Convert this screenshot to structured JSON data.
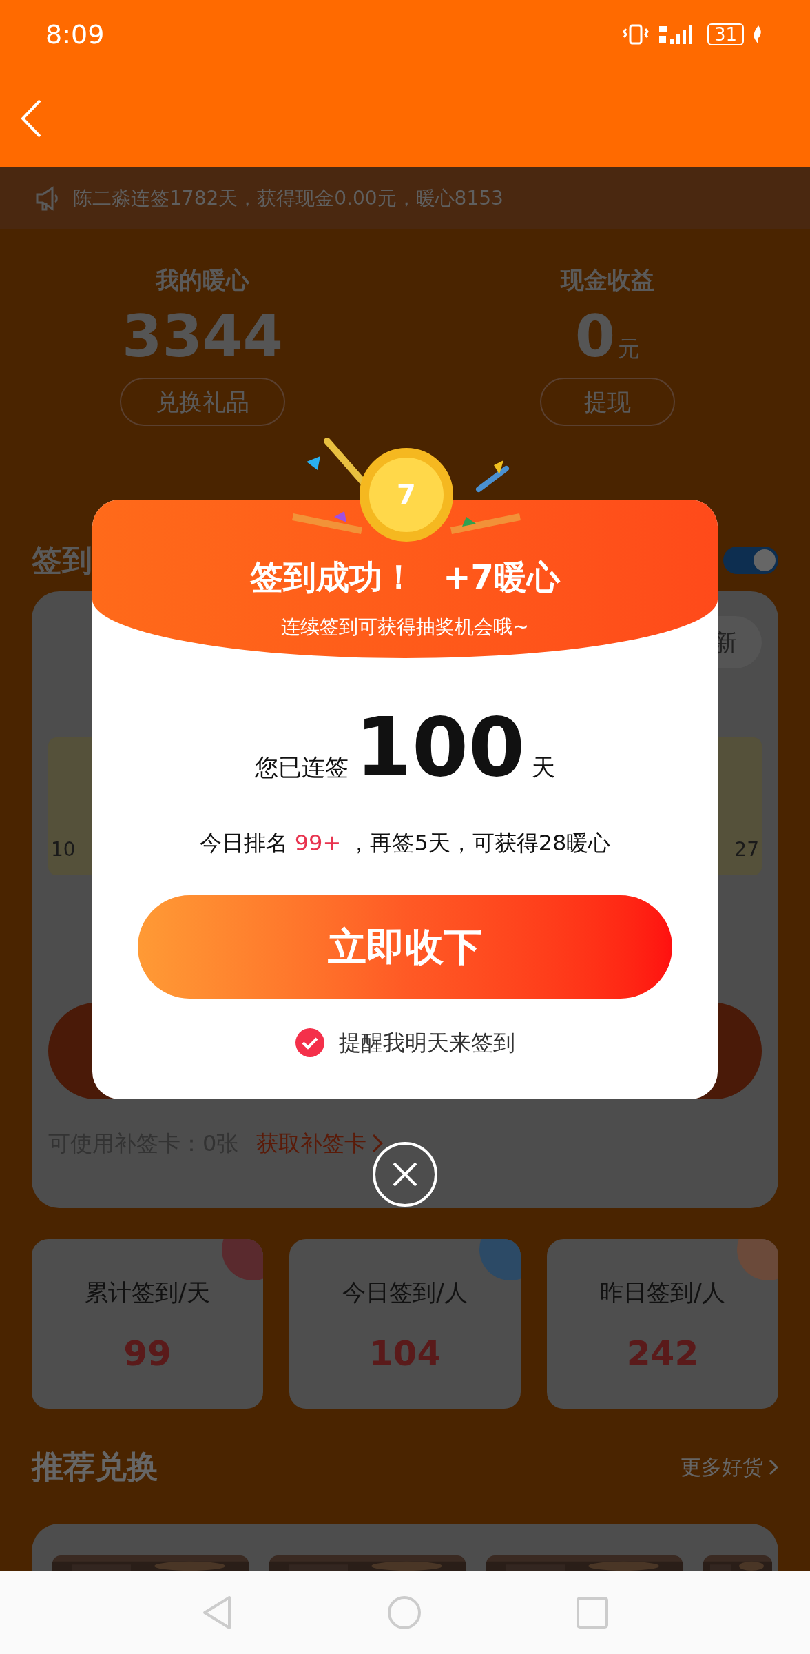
{
  "status_bar": {
    "time": "8:09",
    "battery": "31"
  },
  "ticker": {
    "text": "陈二淼连签1782天，获得现金0.00元，暖心8153"
  },
  "stats": [
    {
      "title": "我的暖心",
      "value": "3344",
      "button": "兑换礼品"
    },
    {
      "title": "现金收益",
      "value": "0",
      "unit": "元",
      "button": "提现"
    }
  ],
  "checkin": {
    "title": "签到",
    "reminder_toggle": {
      "on": true
    },
    "refresh_button": "新",
    "days": [
      "10",
      "27"
    ],
    "makeup_cards": "可使用补签卡：0张",
    "get_makeup_link": "获取补签卡"
  },
  "summary_cards": [
    {
      "label": "累计签到/天",
      "value": "99",
      "color": "#5a2a2e"
    },
    {
      "label": "今日签到/人",
      "value": "104",
      "color": "#2c4a66"
    },
    {
      "label": "昨日签到/人",
      "value": "242",
      "color": "#6b4a3a"
    }
  ],
  "recommend": {
    "title": "推荐兑换",
    "more_link": "更多好货"
  },
  "dialog": {
    "badge": "7",
    "title": "签到成功！",
    "reward": "+7暖心",
    "subtitle": "连续签到可获得抽奖机会哦~",
    "streak_prefix": "您已连签",
    "streak_days": "100",
    "streak_suffix": "天",
    "rank_label": "今日排名",
    "rank": "99+",
    "rank_rest": "，再签5天，可获得28暖心",
    "accept_button": "立即收下",
    "remind": {
      "label": "提醒我明天来签到",
      "checked": true
    }
  }
}
